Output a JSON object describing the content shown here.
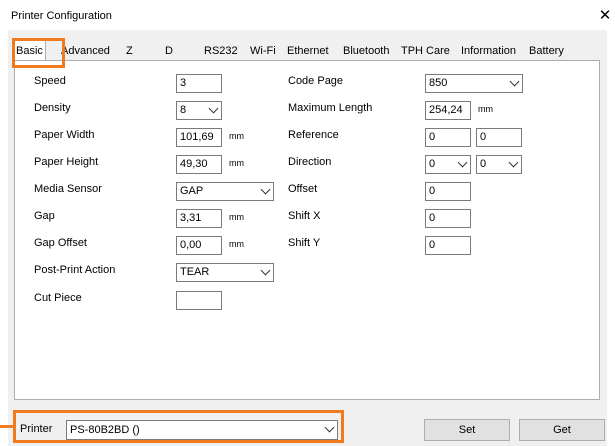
{
  "window": {
    "title": "Printer Configuration",
    "close_glyph": "✕"
  },
  "tabs": [
    "Basic",
    "Advanced",
    "Z",
    "D",
    "RS232",
    "Wi-Fi",
    "Ethernet",
    "Bluetooth",
    "TPH Care",
    "Information",
    "Battery"
  ],
  "active_tab": "Basic",
  "left_fields": {
    "speed": {
      "label": "Speed",
      "value": "3"
    },
    "density": {
      "label": "Density",
      "value": "8"
    },
    "paper_width": {
      "label": "Paper Width",
      "value": "101,69",
      "unit": "mm"
    },
    "paper_height": {
      "label": "Paper Height",
      "value": "49,30",
      "unit": "mm"
    },
    "media_sensor": {
      "label": "Media Sensor",
      "value": "GAP"
    },
    "gap": {
      "label": "Gap",
      "value": "3,31",
      "unit": "mm"
    },
    "gap_offset": {
      "label": "Gap Offset",
      "value": "0,00",
      "unit": "mm"
    },
    "post_print_action": {
      "label": "Post-Print Action",
      "value": "TEAR"
    },
    "cut_piece": {
      "label": "Cut Piece",
      "value": ""
    }
  },
  "right_fields": {
    "code_page": {
      "label": "Code Page",
      "value": "850"
    },
    "maximum_length": {
      "label": "Maximum Length",
      "value": "254,24",
      "unit": "mm"
    },
    "reference": {
      "label": "Reference",
      "value1": "0",
      "value2": "0"
    },
    "direction": {
      "label": "Direction",
      "value1": "0",
      "value2": "0"
    },
    "offset": {
      "label": "Offset",
      "value": "0"
    },
    "shift_x": {
      "label": "Shift X",
      "value": "0"
    },
    "shift_y": {
      "label": "Shift Y",
      "value": "0"
    }
  },
  "footer": {
    "printer_label": "Printer",
    "printer_value": "PS-80B2BD ()",
    "set_label": "Set",
    "get_label": "Get"
  },
  "colors": {
    "highlight": "#f07a1e"
  }
}
